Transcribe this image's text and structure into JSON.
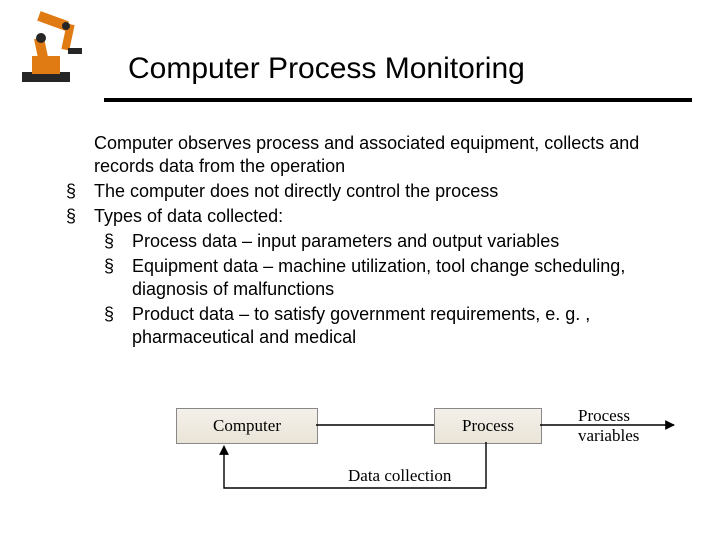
{
  "header": {
    "title": "Computer Process Monitoring"
  },
  "content": {
    "intro": "Computer observes process and associated equipment, collects and records data from the operation",
    "b1": "The computer does not directly control the process",
    "b2": "Types of data collected:",
    "sub": {
      "a": "Process data – input parameters and output variables",
      "b": "Equipment data – machine utilization, tool change scheduling, diagnosis of malfunctions",
      "c": "Product data – to satisfy government requirements, e. g. , pharmaceutical and medical"
    }
  },
  "diagram": {
    "computer": "Computer",
    "process": "Process",
    "process_variables": "Process variables",
    "data_collection": "Data collection"
  },
  "icons": {
    "robot": "industrial-robot-icon"
  }
}
